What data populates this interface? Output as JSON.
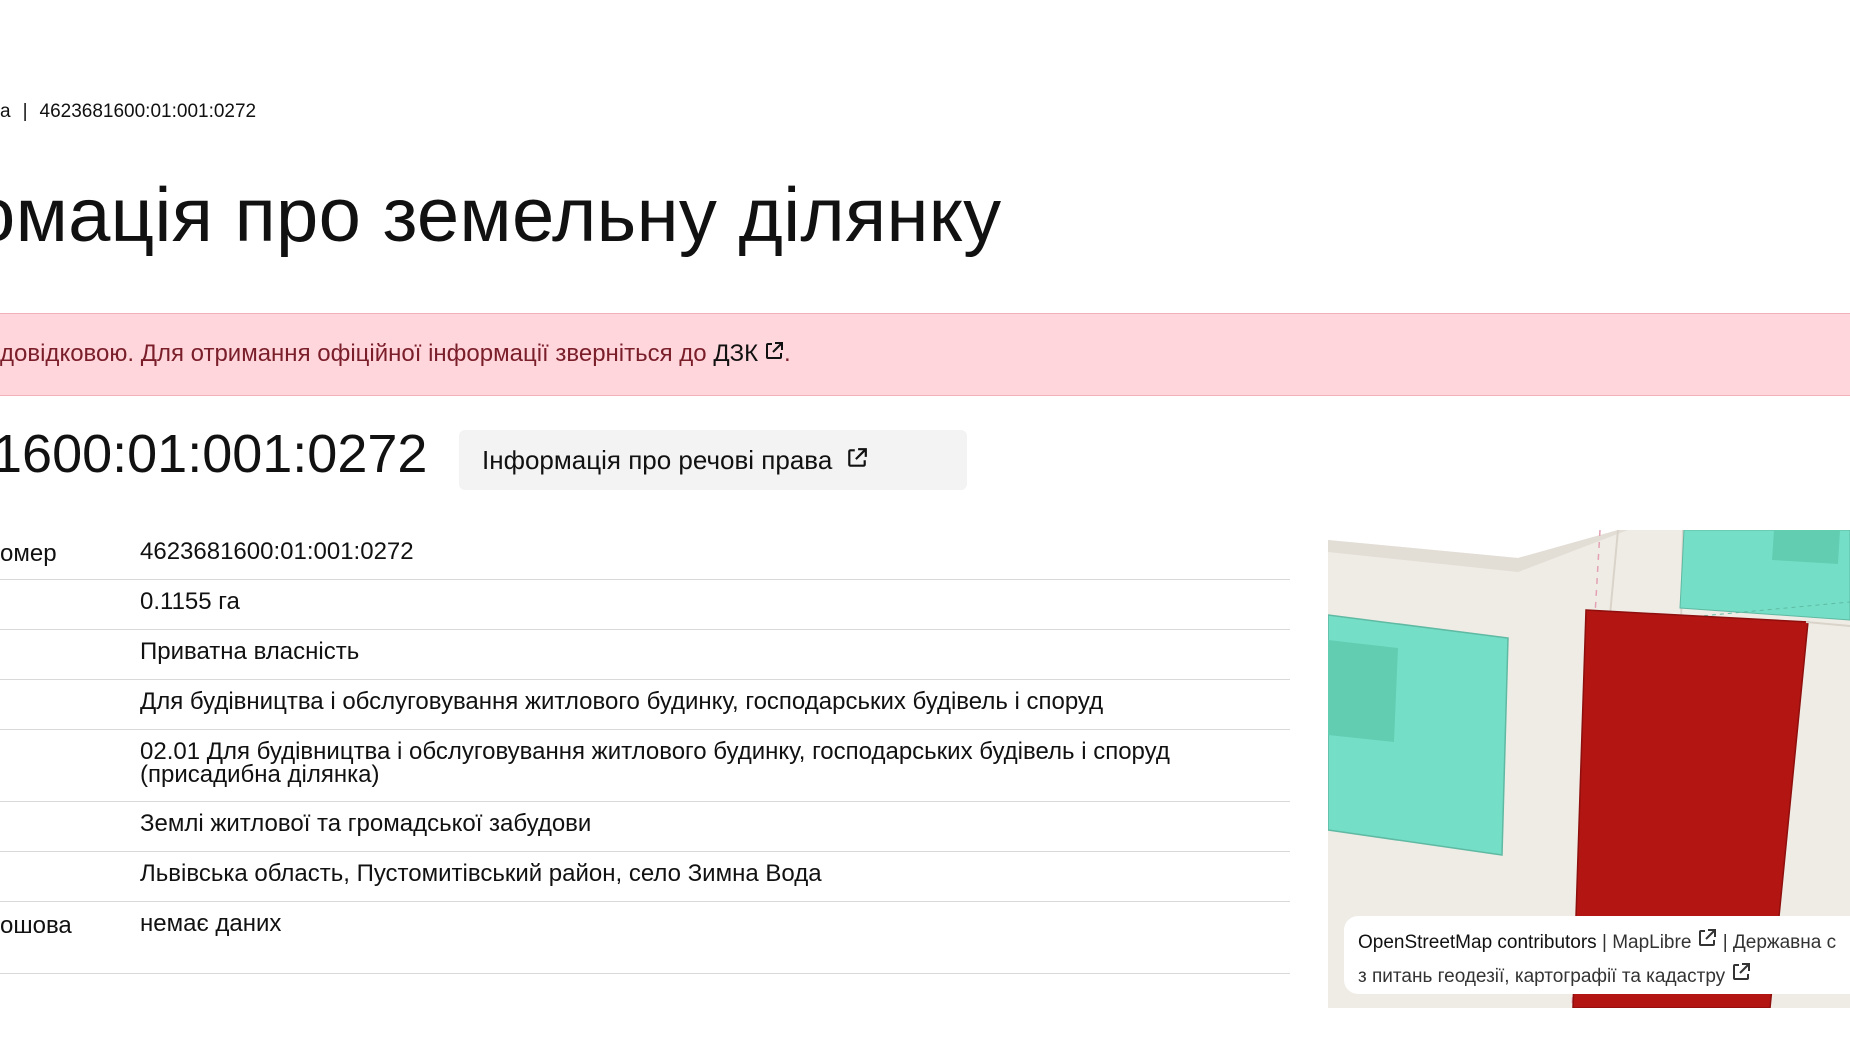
{
  "breadcrumb": {
    "prev": "а",
    "separator": "|",
    "current": "4623681600:01:001:0272"
  },
  "page": {
    "title": "омація про земельну ділянку"
  },
  "alert": {
    "text_before": "довідковою. Для отримання офіційної інформації зверніться до ",
    "link_label": "ДЗК",
    "text_after": ".",
    "background": "#ffd6dc",
    "text_color": "#7a1e2a"
  },
  "parcel": {
    "number_heading": "1600:01:001:0272",
    "rights_button": "Інформація про речові права"
  },
  "table": {
    "rows": [
      {
        "label": "омер",
        "value": "4623681600:01:001:0272"
      },
      {
        "label": "",
        "value": "0.1155 га"
      },
      {
        "label": "",
        "value": "Приватна власність"
      },
      {
        "label": "",
        "value": "Для будівництва і обслуговування житлового будинку, господарських будівель і споруд"
      },
      {
        "label": "",
        "value": "02.01 Для будівництва і обслуговування житлового будинку, господарських будівель і споруд (присадибна ділянка)"
      },
      {
        "label": "",
        "value": "Землі житлової та громадської забудови"
      },
      {
        "label": "",
        "value": "Львівська область, Пустомитівський район, село Зимна Вода"
      },
      {
        "label": "ошова",
        "value": "немає даних"
      }
    ]
  },
  "map": {
    "parcel_color": "#b31512",
    "neighbor_color": "#74dfc6",
    "background": "#efece6",
    "attribution": {
      "osm": "OpenStreetMap contributors",
      "sep1": "|",
      "maplibre": "MapLibre",
      "sep2": "|",
      "agency_line1": "Державна с",
      "agency_line2": "з питань геодезії, картографії та кадастру"
    }
  },
  "icons": {
    "external_link": "external-link-icon"
  }
}
